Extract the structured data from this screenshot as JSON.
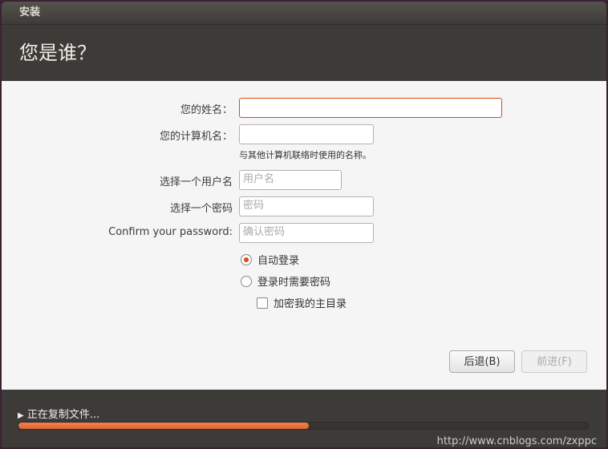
{
  "window": {
    "title": "安装",
    "heading": "您是谁？"
  },
  "form": {
    "name_label": "您的姓名：",
    "name_value": "",
    "computer_label": "您的计算机名：",
    "computer_value": "",
    "computer_hint": "与其他计算机联络时使用的名称。",
    "username_label": "选择一个用户名",
    "username_placeholder": "用户名",
    "password_label": "选择一个密码",
    "password_placeholder": "密码",
    "confirm_label": "Confirm your password:",
    "confirm_placeholder": "确认密码",
    "auto_login": "自动登录",
    "require_password": "登录时需要密码",
    "encrypt_home": "加密我的主目录"
  },
  "buttons": {
    "back": "后退(B)",
    "forward": "前进(F)"
  },
  "status": {
    "text": "正在复制文件...",
    "progress": 0.51
  },
  "watermark": "http://www.cnblogs.com/zxppc",
  "colors": {
    "accent": "#dd4814",
    "progress": "#e8703a"
  }
}
